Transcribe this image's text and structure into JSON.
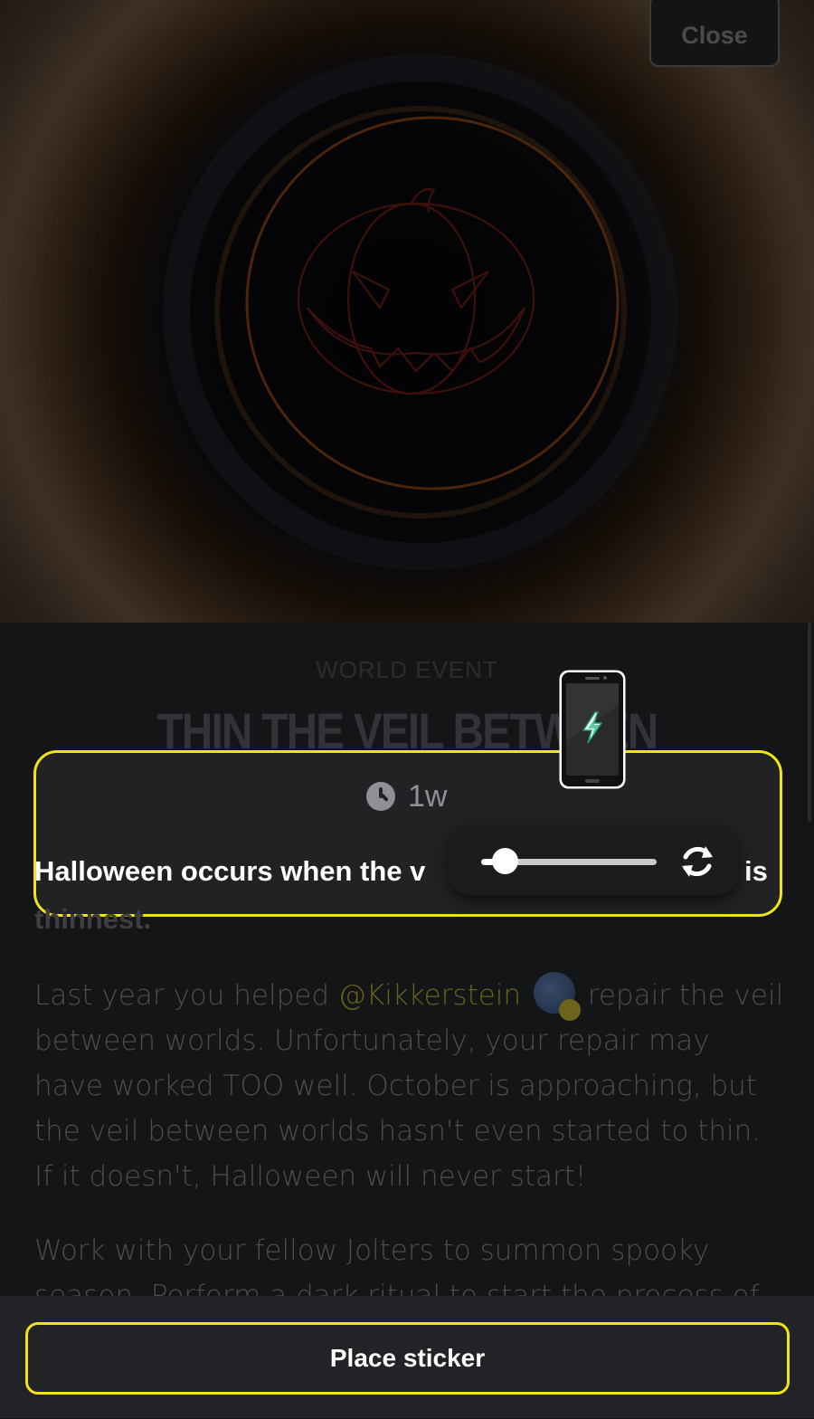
{
  "header": {
    "close_label": "Close"
  },
  "event": {
    "eyebrow": "WORLD EVENT",
    "title": "THIN THE VEIL BETWEEN WORLDS",
    "time_left": "1w",
    "lead_visible": "Halloween occurs when the v",
    "lead_end": "is",
    "lead_line2": "thinnest."
  },
  "description": {
    "p1_before": "Last year you helped ",
    "mention": "@Kikkerstein",
    "p1_after": " repair the veil between worlds. Unfortunately, your repair may have worked TOO well. October is approaching, but the veil between worlds hasn't even started to thin. If it doesn't, Halloween will never start!",
    "p2": "Work with your fellow Jolters to summon spooky season. Perform a dark ritual to start the process of"
  },
  "sticker_editor": {
    "size_slider": 0.1
  },
  "footer": {
    "place_sticker_label": "Place sticker"
  },
  "colors": {
    "accent": "#f2e21a",
    "background": "#141517"
  }
}
